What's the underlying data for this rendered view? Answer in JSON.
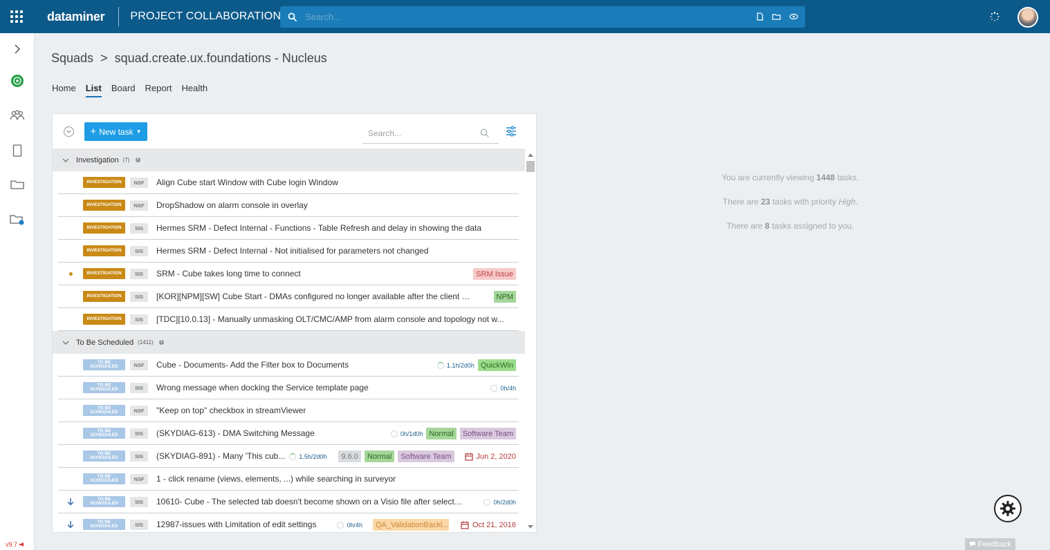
{
  "topbar": {
    "logo": "dataminer",
    "app_title": "PROJECT COLLABORATION",
    "search_placeholder": "Search..."
  },
  "sidebar": {
    "version": "v9.7"
  },
  "breadcrumb": {
    "root": "Squads",
    "separator": ">",
    "current": "squad.create.ux.foundations - Nucleus"
  },
  "tabs": [
    {
      "label": "Home",
      "active": false
    },
    {
      "label": "List",
      "active": true
    },
    {
      "label": "Board",
      "active": false
    },
    {
      "label": "Report",
      "active": false
    },
    {
      "label": "Health",
      "active": false
    }
  ],
  "toolbar": {
    "new_task_label": "New task",
    "search_placeholder": "Search..."
  },
  "groups": [
    {
      "name": "Investigation",
      "count": "(7)",
      "status_label": "INVESTIGATION",
      "rows": [
        {
          "project": "NSF",
          "title": "Align Cube start Window with Cube login Window"
        },
        {
          "project": "NSF",
          "title": "DropShadow on alarm console in overlay"
        },
        {
          "project": "SIS",
          "title": "Hermes SRM - Defect Internal - Functions - Table Refresh and delay in showing the data"
        },
        {
          "project": "SIS",
          "title": "Hermes SRM - Defect Internal - Not initialised for parameters not changed"
        },
        {
          "project": "SIS",
          "title": "SRM - Cube takes long time to connect",
          "tag": "SRM Issue"
        },
        {
          "project": "SIS",
          "title": "[KOR][NPM][SW] Cube Start - DMAs configured no longer available after the client up...",
          "tag": "NPM"
        },
        {
          "project": "SIS",
          "title": "[TDC][10.0.13] - Manually unmasking OLT/CMC/AMP from alarm console and topology not w..."
        }
      ]
    },
    {
      "name": "To Be Scheduled",
      "count": "(1411)",
      "status_label_1": "TO BE",
      "status_label_2": "SCHEDULED",
      "rows": [
        {
          "project": "NSF",
          "title": "Cube - Documents- Add the Filter box to Documents",
          "effort": "1.1h/2d0h",
          "tag": "QuickWin"
        },
        {
          "project": "SIS",
          "title": "Wrong message when docking the Service template page",
          "effort": "0h/4h"
        },
        {
          "project": "NSF",
          "title": "\"Keep on top\" checkbox in streamViewer"
        },
        {
          "project": "SIS",
          "title": "(SKYDIAG-613) - DMA Switching Message",
          "effort": "0h/1d0h",
          "tag": "Normal",
          "tag2": "Software Team"
        },
        {
          "project": "SIS",
          "title": "(SKYDIAG-891) - Many 'This cub...",
          "effort": "1.5h/2d0h",
          "version": "9.6.0",
          "tag": "Normal",
          "tag2": "Software Team",
          "due": "Jun 2, 2020"
        },
        {
          "project": "NSF",
          "title": "1 - click rename (views, elements, ...) while searching in surveyor"
        },
        {
          "project": "SIS",
          "title": "10610- Cube - The selected tab doesn't become shown on a Visio file after selectin...",
          "effort": "0h/2d0h"
        },
        {
          "project": "SIS",
          "title": "12987-issues with Limitation of edit settings",
          "effort": "0h/4h",
          "tag": "QA_ValidationBackl...",
          "due": "Oct 21, 2016"
        }
      ]
    }
  ],
  "stats": {
    "line1_pre": "You are currently viewing ",
    "line1_num": "1448",
    "line1_post": " tasks.",
    "line2_pre": "There are ",
    "line2_num": "23",
    "line2_mid": " tasks with priority ",
    "line2_em": "High",
    "line2_post": ".",
    "line3_pre": "There are ",
    "line3_num": "8",
    "line3_post": " tasks assigned to you."
  },
  "feedback_label": "Feedback",
  "colors": {
    "topbar": "#0c5a8a",
    "accent": "#1e9ce6",
    "investigation": "#c98a16",
    "to_be_scheduled": "#a9c7e6"
  }
}
